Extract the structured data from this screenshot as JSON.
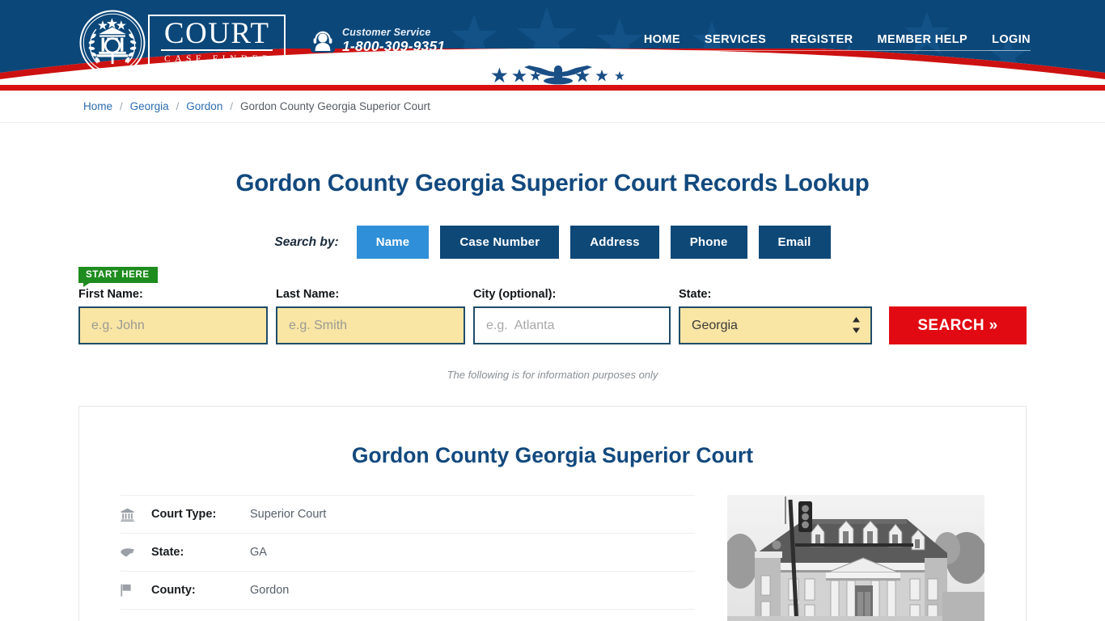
{
  "header": {
    "logo": {
      "emblem_icon": "court-seal-emblem-icon",
      "word": "COURT",
      "subword": "CASE FINDER"
    },
    "customer_service": {
      "icon": "headset-support-icon",
      "label": "Customer Service",
      "phone": "1-800-309-9351"
    },
    "nav": [
      {
        "label": "HOME",
        "name": "nav-home"
      },
      {
        "label": "SERVICES",
        "name": "nav-services"
      },
      {
        "label": "REGISTER",
        "name": "nav-register"
      },
      {
        "label": "MEMBER HELP",
        "name": "nav-member-help"
      },
      {
        "label": "LOGIN",
        "name": "nav-login"
      }
    ],
    "colors": {
      "navy": "#0b4779",
      "red": "#d81010",
      "white": "#ffffff"
    }
  },
  "breadcrumb": {
    "separator": "/",
    "items": [
      {
        "label": "Home",
        "link": true
      },
      {
        "label": "Georgia",
        "link": true
      },
      {
        "label": "Gordon",
        "link": true
      },
      {
        "label": "Gordon County Georgia Superior Court",
        "link": false
      }
    ]
  },
  "main": {
    "page_title": "Gordon County Georgia Superior Court Records Lookup",
    "search_by_label": "Search by:",
    "tabs": [
      {
        "label": "Name",
        "active": true
      },
      {
        "label": "Case Number",
        "active": false
      },
      {
        "label": "Address",
        "active": false
      },
      {
        "label": "Phone",
        "active": false
      },
      {
        "label": "Email",
        "active": false
      }
    ],
    "start_badge": "START HERE",
    "form": {
      "first_name": {
        "label": "First Name:",
        "value": "",
        "placeholder": "e.g. John"
      },
      "last_name": {
        "label": "Last Name:",
        "value": "",
        "placeholder": "e.g. Smith"
      },
      "city": {
        "label": "City (optional):",
        "value": "",
        "placeholder": "e.g.  Atlanta"
      },
      "state": {
        "label": "State:",
        "value": "Georgia",
        "options": [
          "Georgia"
        ]
      },
      "search_button": "SEARCH  »"
    },
    "disclaimer": "The following is for information purposes only"
  },
  "card": {
    "title": "Gordon County Georgia Superior Court",
    "details": [
      {
        "icon": "bank-courthouse-icon",
        "key": "Court Type:",
        "value": "Superior Court"
      },
      {
        "icon": "us-map-icon",
        "key": "State:",
        "value": "GA"
      },
      {
        "icon": "flag-icon",
        "key": "County:",
        "value": "Gordon"
      }
    ],
    "photo_alt": "courthouse-photo"
  },
  "colors": {
    "title_blue": "#12497e",
    "tab_active_blue": "#2f8fd8",
    "tab_blue": "#0d4877",
    "search_red": "#e10a12",
    "badge_green": "#1e8c1e",
    "field_yellow": "#f9e5a4",
    "field_border": "#1e4c69"
  }
}
